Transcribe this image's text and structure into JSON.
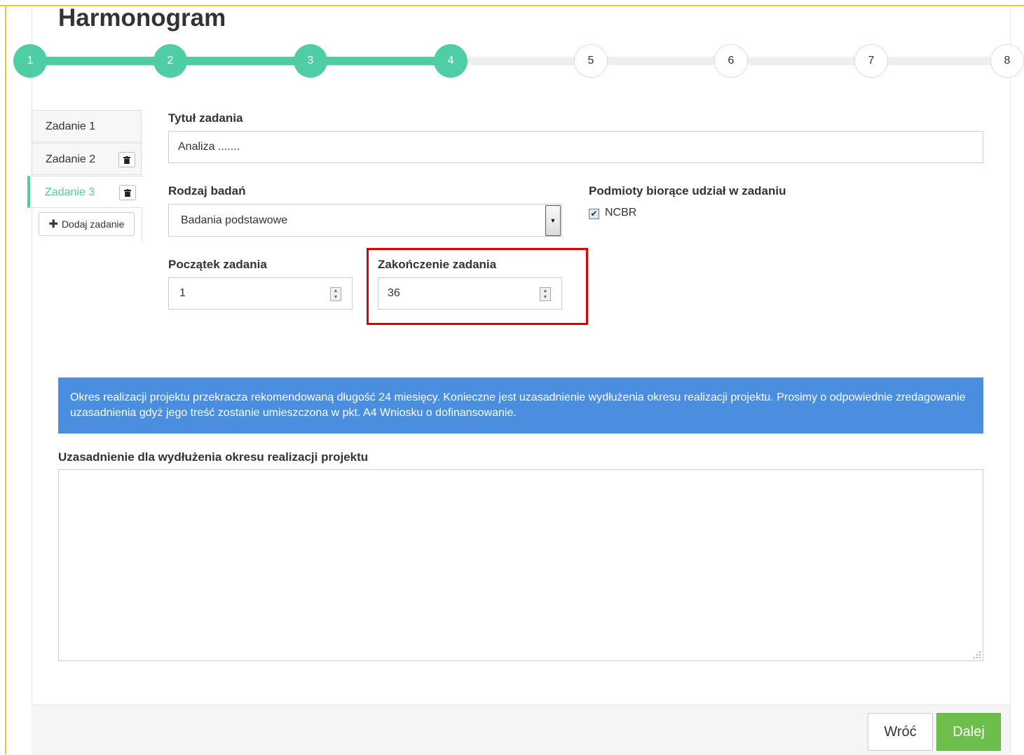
{
  "page": {
    "title": "Harmonogram"
  },
  "stepper": {
    "steps": [
      {
        "label": "1",
        "state": "done"
      },
      {
        "label": "2",
        "state": "done"
      },
      {
        "label": "3",
        "state": "done"
      },
      {
        "label": "4",
        "state": "done"
      },
      {
        "label": "5",
        "state": "todo"
      },
      {
        "label": "6",
        "state": "todo"
      },
      {
        "label": "7",
        "state": "todo"
      },
      {
        "label": "8",
        "state": "todo"
      }
    ],
    "active_step": 4,
    "colors": {
      "done": "#4fcea5",
      "todo": "#eeeeee"
    }
  },
  "task_tabs": {
    "items": [
      {
        "label": "Zadanie 1",
        "deletable": false,
        "active": false
      },
      {
        "label": "Zadanie 2",
        "deletable": true,
        "active": false
      },
      {
        "label": "Zadanie 3",
        "deletable": true,
        "active": true
      }
    ],
    "add_label": "Dodaj zadanie",
    "trash_icon": "trash-icon",
    "plus_icon": "plus-icon"
  },
  "form": {
    "task_title": {
      "label": "Tytuł zadania",
      "value": "Analiza ......."
    },
    "research_type": {
      "label": "Rodzaj badań",
      "value": "Badania podstawowe"
    },
    "participants": {
      "label": "Podmioty biorące udział w zadaniu",
      "options": [
        {
          "label": "NCBR",
          "checked": true
        }
      ]
    },
    "start": {
      "label": "Początek zadania",
      "value": "1"
    },
    "end": {
      "label": "Zakończenie zadania",
      "value": "36"
    }
  },
  "alert": {
    "text": "Okres realizacji projektu przekracza rekomendowaną długość 24 miesięcy. Konieczne jest uzasadnienie wydłużenia okresu realizacji projektu. Prosimy o odpowiednie zredagowanie uzasadnienia gdyż jego treść zostanie umieszczona w pkt. A4 Wniosku o dofinansowanie.",
    "color": "#4a8ee0"
  },
  "justification": {
    "label": "Uzasadnienie dla wydłużenia okresu realizacji projektu",
    "value": ""
  },
  "footer": {
    "back_label": "Wróć",
    "next_label": "Dalej",
    "next_color": "#6dbf4b"
  },
  "annotation": {
    "highlight_color": "#e00000"
  }
}
